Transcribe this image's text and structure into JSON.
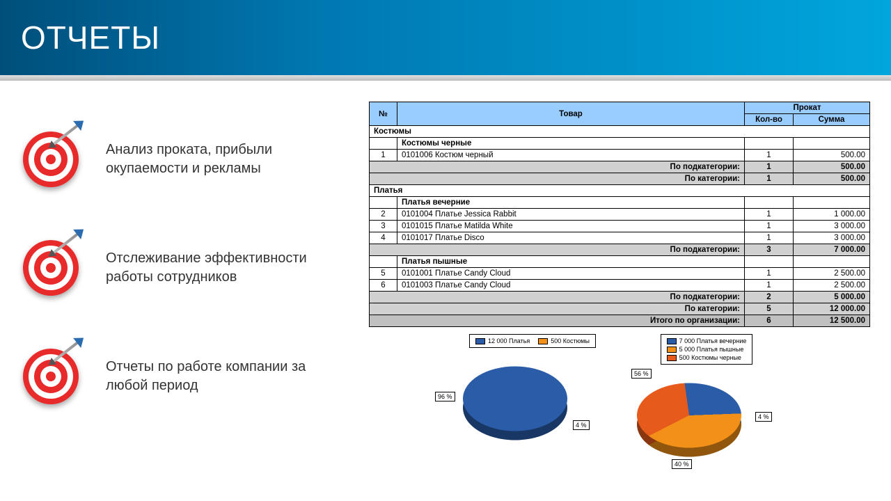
{
  "header": {
    "title": "ОТЧЕТЫ"
  },
  "bullets": [
    "Анализ проката, прибыли окупаемости и рекламы",
    "Отслеживание эффективности работы сотрудников",
    "Отчеты по работе компании за любой период"
  ],
  "table": {
    "headers": {
      "num": "№",
      "item": "Товар",
      "rental": "Прокат",
      "qty": "Кол-во",
      "sum": "Сумма"
    },
    "labels": {
      "subtotal": "По подкатегории:",
      "cattotal": "По категории:",
      "orgtotal": "Итого по организации:"
    },
    "categories": [
      {
        "name": "Костюмы",
        "total_qty": "1",
        "total_sum": "500.00",
        "subcats": [
          {
            "name": "Костюмы черные",
            "total_qty": "1",
            "total_sum": "500.00",
            "rows": [
              {
                "n": "1",
                "code": "0101006 Костюм черный",
                "qty": "1",
                "sum": "500.00"
              }
            ]
          }
        ]
      },
      {
        "name": "Платья",
        "total_qty": "5",
        "total_sum": "12 000.00",
        "subcats": [
          {
            "name": "Платья вечерние",
            "total_qty": "3",
            "total_sum": "7 000.00",
            "rows": [
              {
                "n": "2",
                "code": "0101004 Платье Jessica Rabbit",
                "qty": "1",
                "sum": "1 000.00"
              },
              {
                "n": "3",
                "code": "0101015 Платье Matilda White",
                "qty": "1",
                "sum": "3 000.00"
              },
              {
                "n": "4",
                "code": "0101017 Платье Disco",
                "qty": "1",
                "sum": "3 000.00"
              }
            ]
          },
          {
            "name": "Платья пышные",
            "total_qty": "2",
            "total_sum": "5 000.00",
            "rows": [
              {
                "n": "5",
                "code": "0101001 Платье Candy Cloud",
                "qty": "1",
                "sum": "2 500.00"
              },
              {
                "n": "6",
                "code": "0101003 Платье Candy Cloud",
                "qty": "1",
                "sum": "2 500.00"
              }
            ]
          }
        ]
      }
    ],
    "org": {
      "qty": "6",
      "sum": "12 500.00"
    }
  },
  "chart_data": [
    {
      "type": "pie",
      "legend": [
        {
          "label": "12 000 Платья",
          "color": "#2a5ca8"
        },
        {
          "label": "500 Костюмы",
          "color": "#f29018"
        }
      ],
      "slices": [
        {
          "value": 12000,
          "pct": 96,
          "label": "96 %",
          "color": "#2a5ca8"
        },
        {
          "value": 500,
          "pct": 4,
          "label": "4 %",
          "color": "#f29018"
        }
      ]
    },
    {
      "type": "pie",
      "legend": [
        {
          "label": "7 000 Платья вечерние",
          "color": "#2a5ca8"
        },
        {
          "label": "5 000 Платья пышные",
          "color": "#f29018"
        },
        {
          "label": "500 Костюмы черные",
          "color": "#e65a1c"
        }
      ],
      "slices": [
        {
          "value": 7000,
          "pct": 56,
          "label": "56 %",
          "color": "#2a5ca8"
        },
        {
          "value": 5000,
          "pct": 40,
          "label": "40 %",
          "color": "#f29018"
        },
        {
          "value": 500,
          "pct": 4,
          "label": "4 %",
          "color": "#e65a1c"
        }
      ]
    }
  ]
}
